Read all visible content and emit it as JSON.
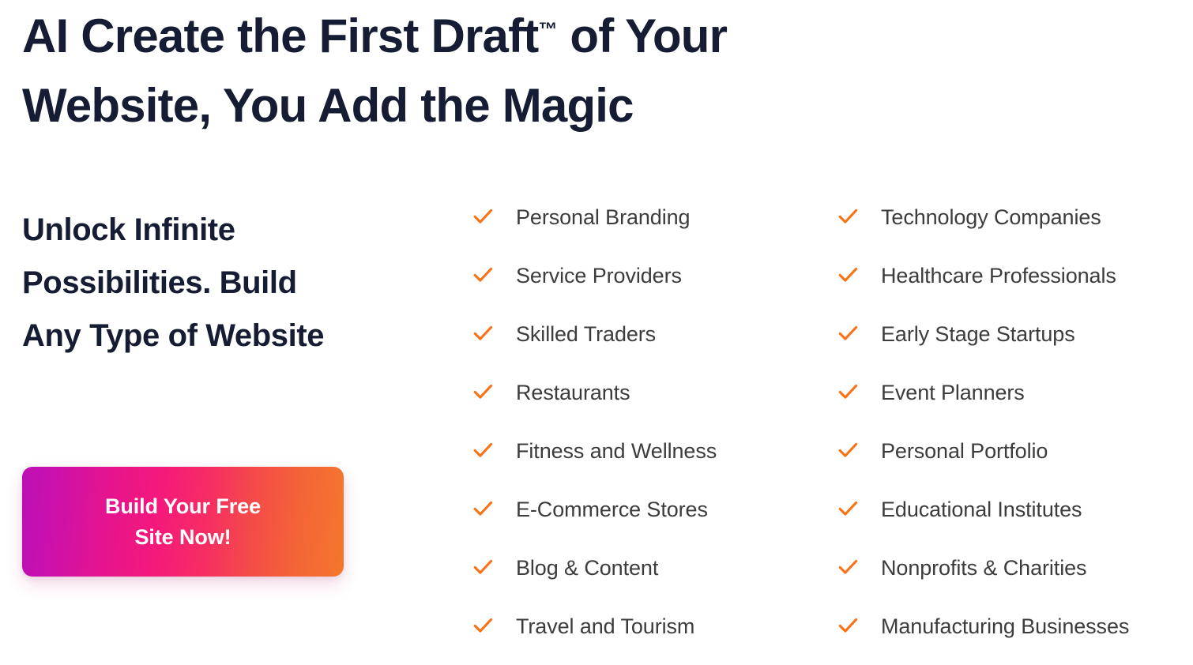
{
  "hero": {
    "headline_part1": "AI Create the First Draft",
    "headline_trademark": "™",
    "headline_part2": " of Your Website, You Add the Magic",
    "subheadline": "Unlock Infinite Possibilities. Build Any Type of Website",
    "cta_label": "Build Your Free\nSite Now!"
  },
  "colors": {
    "heading": "#151C33",
    "body_text": "#3C3C3C",
    "check_orange": "#F97316",
    "cta_gradient_start": "#BD0FB5",
    "cta_gradient_mid": "#F5197A",
    "cta_gradient_end": "#F4772D",
    "background": "#FFFFFF"
  },
  "checklist": {
    "icon": "check-icon",
    "column_left": [
      {
        "label": "Personal Branding"
      },
      {
        "label": "Service Providers"
      },
      {
        "label": "Skilled Traders"
      },
      {
        "label": "Restaurants"
      },
      {
        "label": "Fitness and Wellness"
      },
      {
        "label": "E-Commerce Stores"
      },
      {
        "label": "Blog & Content"
      },
      {
        "label": "Travel and Tourism"
      }
    ],
    "column_right": [
      {
        "label": "Technology Companies"
      },
      {
        "label": "Healthcare Professionals"
      },
      {
        "label": "Early Stage Startups"
      },
      {
        "label": "Event Planners"
      },
      {
        "label": "Personal Portfolio"
      },
      {
        "label": "Educational Institutes"
      },
      {
        "label": "Nonprofits & Charities"
      },
      {
        "label": "Manufacturing Businesses"
      }
    ]
  }
}
